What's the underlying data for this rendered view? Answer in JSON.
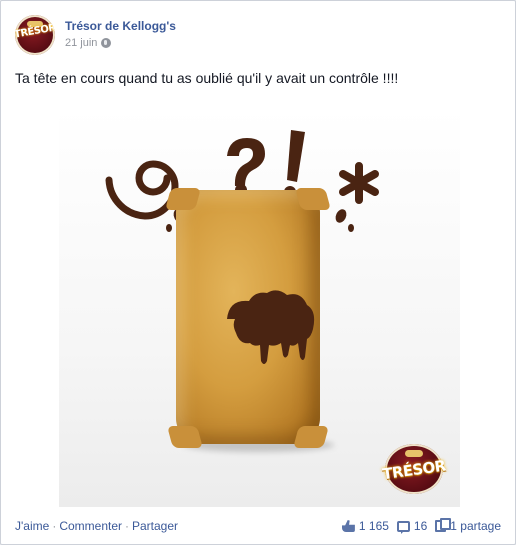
{
  "post": {
    "author": "Trésor de Kellogg's",
    "date": "21 juin",
    "privacy_icon": "globe-icon",
    "message": "Ta tête en cours quand tu as oublié qu'il y avait un contrôle !!!!",
    "avatar_logo": "TRÉSOR"
  },
  "photo": {
    "symbols": [
      "@",
      "?",
      "!",
      "*"
    ],
    "brand_wordmark": "TRÉSOR",
    "colors": {
      "chocolate": "#4a2412",
      "cereal": "#d49d3f"
    }
  },
  "actions": {
    "like": "J'aime",
    "comment": "Commenter",
    "share": "Partager",
    "separator": "·"
  },
  "stats": {
    "likes": "1 165",
    "comments": "16",
    "shares": "1 partage"
  },
  "colors": {
    "link": "#3b5998",
    "muted": "#90949c",
    "text": "#141823"
  }
}
